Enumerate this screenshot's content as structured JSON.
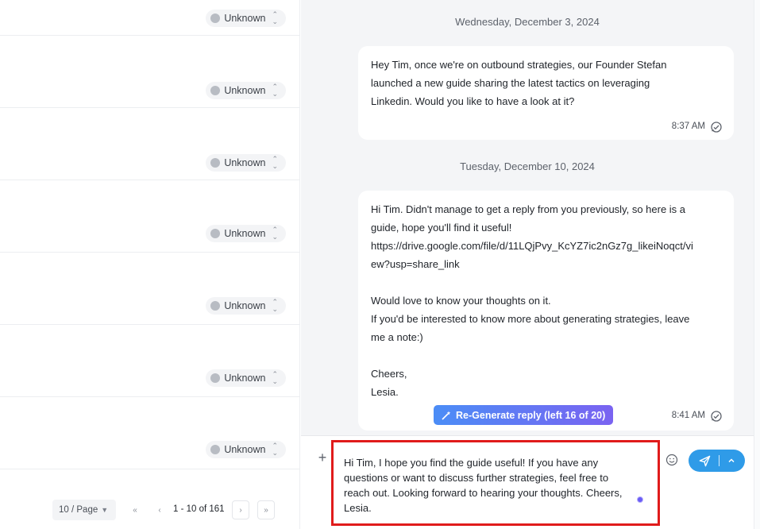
{
  "list": {
    "rows": [
      {
        "status": "Unknown"
      },
      {
        "status": "Unknown"
      },
      {
        "status": "Unknown"
      },
      {
        "status": "Unknown"
      },
      {
        "status": "Unknown"
      },
      {
        "status": "Unknown"
      },
      {
        "status": "Unknown"
      }
    ],
    "pagination": {
      "page_size": "10 / Page",
      "first": "«",
      "prev": "‹",
      "range": "1 - 10 of 161",
      "next": "›",
      "last": "»"
    }
  },
  "chat": {
    "messages": [
      {
        "date": "Wednesday, December 3, 2024",
        "lines": [
          "Hey Tim, once we're on outbound strategies, our Founder Stefan",
          "launched a new guide sharing the latest tactics on leveraging",
          "Linkedin. Would you like to have a look at it?"
        ],
        "time": "8:37 AM"
      },
      {
        "date": "Tuesday, December 10, 2024",
        "lines": [
          "Hi Tim. Didn't manage to get a reply from you previously, so here is a",
          "guide, hope you'll find it useful!",
          "https://drive.google.com/file/d/11LQjPvy_KcYZ7ic2nGz7g_likeiNoqct/vi",
          "ew?usp=share_link",
          "",
          "Would love to know your thoughts on it.",
          "If you'd be interested to know more about generating strategies, leave",
          "me a note:)",
          "",
          "Cheers,",
          "Lesia."
        ],
        "time": "8:41 AM",
        "regenerate_label": "Re-Generate reply (left 16 of 20)"
      }
    ]
  },
  "composer": {
    "draft_lines": [
      "Hi Tim, I hope you find the guide useful! If you have any",
      "questions or want to discuss further strategies, feel free to",
      "reach out. Looking forward to hearing your thoughts. Cheers,",
      "Lesia."
    ]
  },
  "colors": {
    "highlight_border": "#e01b1b",
    "send_button": "#2f9be8",
    "regenerate_gradient_start": "#4b8df6",
    "regenerate_gradient_end": "#7a63f1",
    "chat_background": "#f4f5f7"
  },
  "icons": {
    "status_dot": "status-dot-icon",
    "status_arrows": "sort-arrows-icon",
    "read_receipt": "read-receipt-icon",
    "regenerate": "magic-wand-icon",
    "attach": "plus-icon",
    "emoji": "smiley-icon",
    "send": "paper-plane-icon",
    "send_options": "chevron-up-icon"
  }
}
